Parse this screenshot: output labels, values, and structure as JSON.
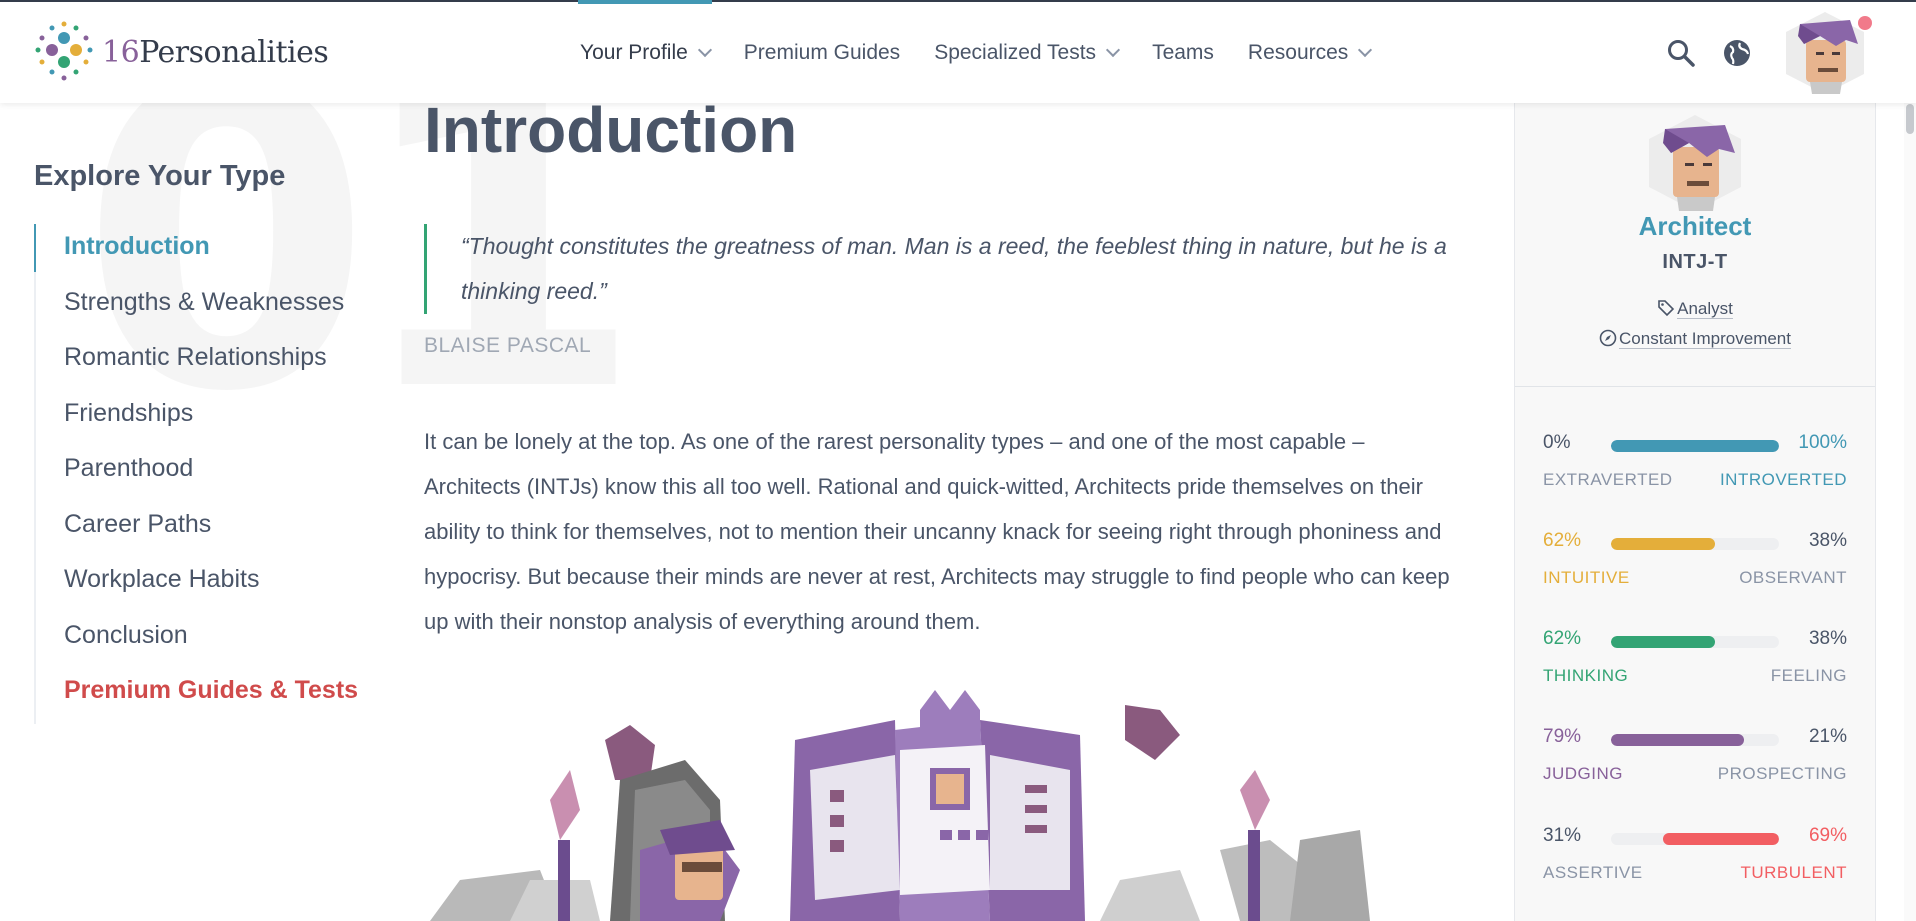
{
  "brand": {
    "name_num": "16",
    "name_text": "Personalities"
  },
  "nav": {
    "items": [
      {
        "label": "Your Profile",
        "dropdown": true,
        "active": true
      },
      {
        "label": "Premium Guides",
        "dropdown": false
      },
      {
        "label": "Specialized Tests",
        "dropdown": true
      },
      {
        "label": "Teams",
        "dropdown": false
      },
      {
        "label": "Resources",
        "dropdown": true
      }
    ]
  },
  "bg_number": "01",
  "sidebar": {
    "title": "Explore Your Type",
    "items": [
      {
        "label": "Introduction"
      },
      {
        "label": "Strengths & Weaknesses"
      },
      {
        "label": "Romantic Relationships"
      },
      {
        "label": "Friendships"
      },
      {
        "label": "Parenthood"
      },
      {
        "label": "Career Paths"
      },
      {
        "label": "Workplace Habits"
      },
      {
        "label": "Conclusion"
      },
      {
        "label": "Premium Guides & Tests"
      }
    ]
  },
  "main": {
    "title": "Introduction",
    "quote": "“Thought constitutes the greatness of man. Man is a reed, the feeblest thing in nature, but he is a thinking reed.”",
    "quote_author": "BLAISE PASCAL",
    "body": "It can be lonely at the top. As one of the rarest personality types – and one of the most capable – Architects (INTJs) know this all too well. Rational and quick-witted, Architects pride themselves on their ability to think for themselves, not to mention their uncanny knack for seeing right through phoniness and hypocrisy. But because their minds are never at rest, Architects may struggle to find people who can keep up with their nonstop analysis of everything around them."
  },
  "panel": {
    "type_name": "Architect",
    "type_code": "INTJ-T",
    "role": "Analyst",
    "strategy": "Constant Improvement",
    "traits": [
      {
        "left_pct": "0%",
        "right_pct": "100%",
        "left_label": "EXTRAVERTED",
        "right_label": "INTROVERTED",
        "fill": 1.0,
        "side": "right",
        "color": "#4298b4"
      },
      {
        "left_pct": "62%",
        "right_pct": "38%",
        "left_label": "INTUITIVE",
        "right_label": "OBSERVANT",
        "fill": 0.62,
        "side": "left",
        "color": "#e4ae3a"
      },
      {
        "left_pct": "62%",
        "right_pct": "38%",
        "left_label": "THINKING",
        "right_label": "FEELING",
        "fill": 0.62,
        "side": "left",
        "color": "#33a474"
      },
      {
        "left_pct": "79%",
        "right_pct": "21%",
        "left_label": "JUDGING",
        "right_label": "PROSPECTING",
        "fill": 0.79,
        "side": "left",
        "color": "#88619a"
      },
      {
        "left_pct": "31%",
        "right_pct": "69%",
        "left_label": "ASSERTIVE",
        "right_label": "TURBULENT",
        "fill": 0.69,
        "side": "right",
        "color": "#f25e62"
      }
    ]
  },
  "colors": {
    "accent": "#4298b4",
    "text": "#4a5568",
    "premium": "#d04b4b",
    "quote_border": "#33a474"
  }
}
